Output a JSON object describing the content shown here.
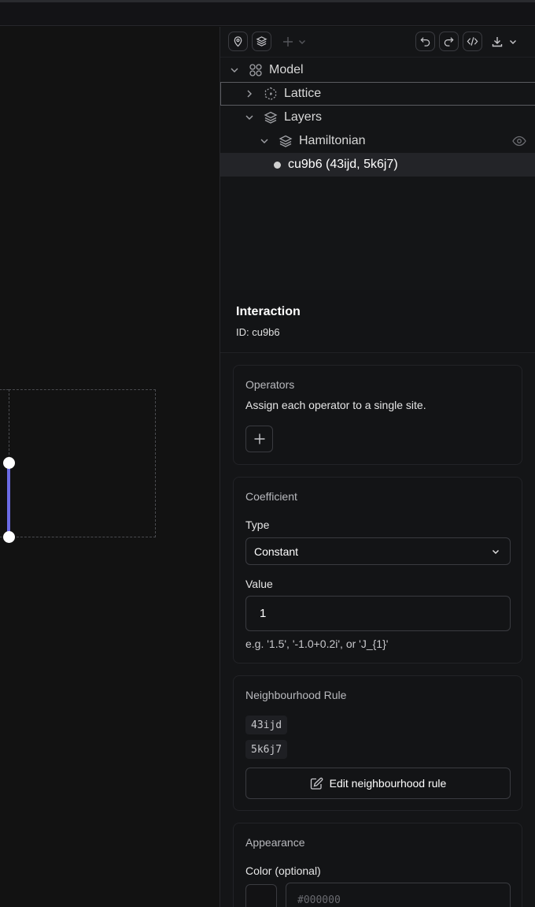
{
  "toolbar": {
    "icons": [
      "map-pin-icon",
      "layers-icon",
      "plus-icon",
      "chevron-down-icon",
      "undo-icon",
      "redo-icon",
      "code-icon",
      "download-icon",
      "chevron-down-icon"
    ]
  },
  "tree": {
    "model_label": "Model",
    "lattice_label": "Lattice",
    "layers_label": "Layers",
    "hamiltonian_label": "Hamiltonian",
    "interaction_label": "cu9b6 (43ijd, 5k6j7)"
  },
  "details": {
    "title": "Interaction",
    "id_line": "ID: cu9b6"
  },
  "operators": {
    "title": "Operators",
    "description": "Assign each operator to a single site."
  },
  "coefficient": {
    "title": "Coefficient",
    "type_label": "Type",
    "type_value": "Constant",
    "value_label": "Value",
    "value": "1",
    "hint": "e.g. '1.5', '-1.0+0.2i', or 'J_{1}'"
  },
  "neighbourhood": {
    "title": "Neighbourhood Rule",
    "sites": [
      "43ijd",
      "5k6j7"
    ],
    "edit_label": "Edit neighbourhood rule"
  },
  "appearance": {
    "title": "Appearance",
    "color_label": "Color (optional)",
    "color_placeholder": "#000000"
  },
  "colors": {
    "background": "#111112",
    "bond": "#6c6ce6",
    "node": "#ffffff"
  }
}
